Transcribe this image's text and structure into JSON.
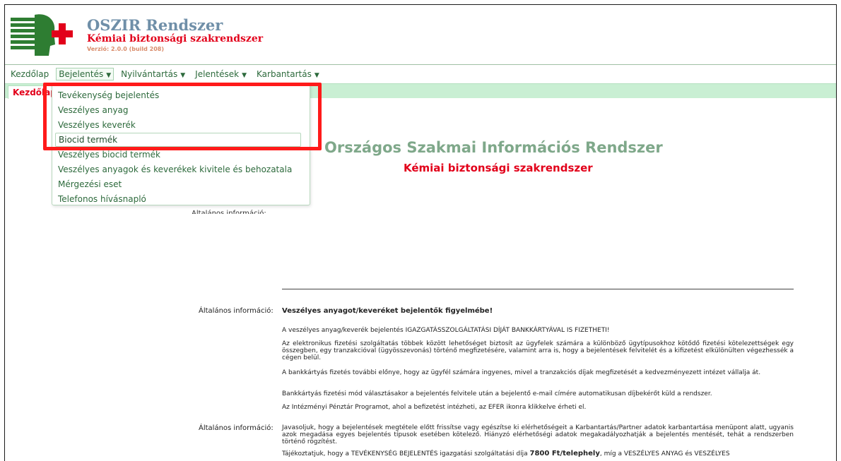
{
  "header": {
    "title": "OSZIR Rendszer",
    "subtitle": "Kémiai biztonsági szakrendszer",
    "version": "Verzió: 2.0.0 (build 208)"
  },
  "menu": [
    {
      "label": "Kezdőlap"
    },
    {
      "label": "Bejelentés"
    },
    {
      "label": "Nyilvántartás"
    },
    {
      "label": "Jelentések"
    },
    {
      "label": "Karbantartás"
    }
  ],
  "tabs": [
    {
      "label": "Kezdőlap"
    }
  ],
  "dropdown": {
    "items": [
      "Tevékenység bejelentés",
      "Veszélyes anyag",
      "Veszélyes keverék",
      "Biocid termék",
      "Veszélyes biocid termék",
      "Veszélyes anyagok és keverékek kivitele és behozatala",
      "Mérgezési eset",
      "Telefonos hívásnapló"
    ],
    "hovered_index": 3
  },
  "main": {
    "title": "Országos Szakmai Információs Rendszer",
    "subtitle": "Kémiai biztonsági szakrendszer",
    "partial_label": "Általános információ:",
    "info_label": "Általános információ:",
    "notice_heading": "Veszélyes anyagot/keveréket bejelentők figyelmébe!",
    "p1": "A veszélyes anyag/keverék bejelentés IGAZGATÁSSZOLGÁLTATÁSI DÍJÁT BANKKÁRTYÁVAL IS FIZETHETI!",
    "p2": "Az elektronikus fizetési szolgáltatás többek között lehetőséget biztosít az ügyfelek számára a különböző ügytípusokhoz kötődő fizetési kötelezettségek egy összegben, egy tranzakcióval (ügyösszevonás) történő megfizetésére, valamint arra is, hogy a bejelentések felvitelét és a kifizetést elkülönülten végezhessék a cégen belül.",
    "p3": "A bankkártyás fizetés további előnye, hogy az ügyfél számára ingyenes, mivel a tranzakciós díjak megfizetését a kedvezményezett intézet vállalja át.",
    "p4": "Bankkártyás fizetési mód választásakor a bejelentés felvitele után a bejelentő e-mail címére automatikusan díjbekérőt küld a rendszer.",
    "p5": "Az Intézményi Pénztár Programot, ahol a befizetést intézheti, az EFER ikonra klikkelve érheti el.",
    "p6": "Javasoljuk, hogy a bejelentések megtétele előtt frissítse vagy egészítse ki elérhetőségeit a Karbantartás/Partner adatok karbantartása menüpont alatt, ugyanis azok megadása egyes bejelentés típusok esetében kötelező. Hiányzó elérhetőségi adatok megakadályozhatják a bejelentés mentését, tehát a rendszerben történő rögzítést.",
    "p7_a": "Tájékoztatjuk, hogy a TEVÉKENYSÉG BEJELENTÉS igazgatási szolgáltatási díja ",
    "p7_b": "7800 Ft/telephely",
    "p7_c": ", míg a VESZÉLYES ANYAG és VESZÉLYES"
  },
  "colors": {
    "brand_red": "#e2001a",
    "menu_green": "#2d6a3c",
    "tab_bg": "#c9efd3",
    "highlight": "#ff1a1a"
  }
}
